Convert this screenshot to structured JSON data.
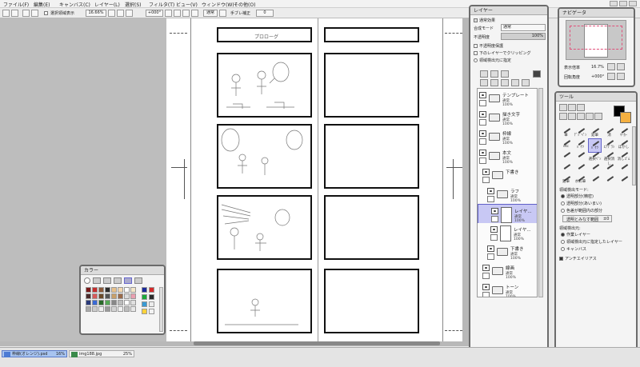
{
  "menu": [
    "ファイル(F)",
    "編集(E)",
    "キャンバス(C)",
    "レイヤー(L)",
    "選択(S)",
    "フィルタ(T)",
    "ビュー(V)",
    "ウィンドウ(W)",
    "その他(O)"
  ],
  "toolbar": {
    "show_selection_label": "選択領域表示",
    "zoom": "16.66%",
    "angle": "+000°",
    "blend": "通常",
    "stabilizer_label": "手ブレ補正",
    "stabilizer_value": "0"
  },
  "canvas": {
    "panel1_caption": "プロローグ"
  },
  "layer_panel": {
    "title": "レイヤー",
    "effect_label": "通常効果",
    "blend_label": "合成モード",
    "blend_value": "通常",
    "opacity_label": "不透明度",
    "opacity_value": "100%",
    "options": [
      "不透明度保護",
      "下のレイヤーでクリッピング",
      "領域検出元に指定"
    ],
    "layers": [
      {
        "name": "テンプレート",
        "mode": "通常",
        "opacity": "100%"
      },
      {
        "name": "描き文字",
        "mode": "通常",
        "opacity": "100%"
      },
      {
        "name": "枠線",
        "mode": "通常",
        "opacity": "100%"
      },
      {
        "name": "本文",
        "mode": "通常",
        "opacity": "100%"
      },
      {
        "name": "下書き",
        "mode": "",
        "opacity": ""
      },
      {
        "name": "ラフ",
        "mode": "通常",
        "opacity": "100%"
      },
      {
        "name": "レイヤ...",
        "mode": "通常",
        "opacity": "100%"
      },
      {
        "name": "レイヤ...",
        "mode": "通常",
        "opacity": "100%"
      },
      {
        "name": "下書き",
        "mode": "通常",
        "opacity": "100%"
      },
      {
        "name": "線画",
        "mode": "通常",
        "opacity": "100%"
      },
      {
        "name": "トーン",
        "mode": "通常",
        "opacity": "100%"
      }
    ]
  },
  "navigator": {
    "title": "ナビゲータ",
    "zoom_label": "表示倍率",
    "zoom_value": "16.7%",
    "rotate_label": "回転角度",
    "rotate_value": "+000°"
  },
  "tool_panel": {
    "title": "ツール",
    "tools": [
      "筆",
      "ﾃﾞｼﾞﾍﾟﾝ",
      "鉛筆",
      "消",
      "ﾏｰｶｰ",
      "etc",
      "ﾊﾞｹﾂ",
      "ﾊﾞｹﾂ",
      "ｴｱﾌﾞﾗｼ",
      "ぼかし",
      "",
      "",
      "選択ﾍﾟﾝ",
      "選択消し",
      "消しｺﾞﾑ",
      "",
      "",
      "",
      "",
      "",
      "",
      "",
      "",
      "",
      "",
      "鉛筆",
      "水彩筆"
    ],
    "detect_mode_label": "領域検出モード:",
    "detect_modes": [
      "透明部分(精密)",
      "透明部分(あいまい)",
      "色差が範囲内の部分"
    ],
    "range_label": "透明とみなす範囲",
    "range_value": "±0",
    "detect_source_label": "領域検出元:",
    "detect_sources": [
      "作業レイヤー",
      "領域検出元に指定したレイヤー",
      "キャンバス"
    ],
    "antialias_label": "アンチエイリアス"
  },
  "color_panel": {
    "title": "カラー",
    "swatches": [
      "#7a1a1a",
      "#c62d2d",
      "#8a5a3a",
      "#2c2c2c",
      "#e6c08a",
      "#f2d7b0",
      "#ffffff",
      "#f4e7c8",
      "#4a2a2a",
      "#d65a5a",
      "#6a4a2a",
      "#555555",
      "#c8a06a",
      "#9a6a4a",
      "#dcdcdc",
      "#e9a0b0",
      "#2a3a7a",
      "#3a6ad4",
      "#2a6a2a",
      "#55a855",
      "#888888",
      "#bbbbbb",
      "#ffffff",
      "#e0e0e0",
      "#aaaaaa",
      "#cccccc",
      "#eeeeee",
      "#999999",
      "#d4d4d4",
      "#f0f0f0",
      "#bdbdbd",
      "#e8e8e8"
    ],
    "right_swatches": [
      "#1a2a9a",
      "#d42a2a",
      "#1aa83a",
      "#2a2a2a",
      "#3a9ad4",
      "#ececec",
      "#ffd23a",
      "#f2f2f2"
    ]
  },
  "taskbar": {
    "items": [
      {
        "name": "枠線(オレンジ).psd",
        "zoom": "16%"
      },
      {
        "name": "img188.jpg",
        "zoom": "25%"
      }
    ]
  }
}
